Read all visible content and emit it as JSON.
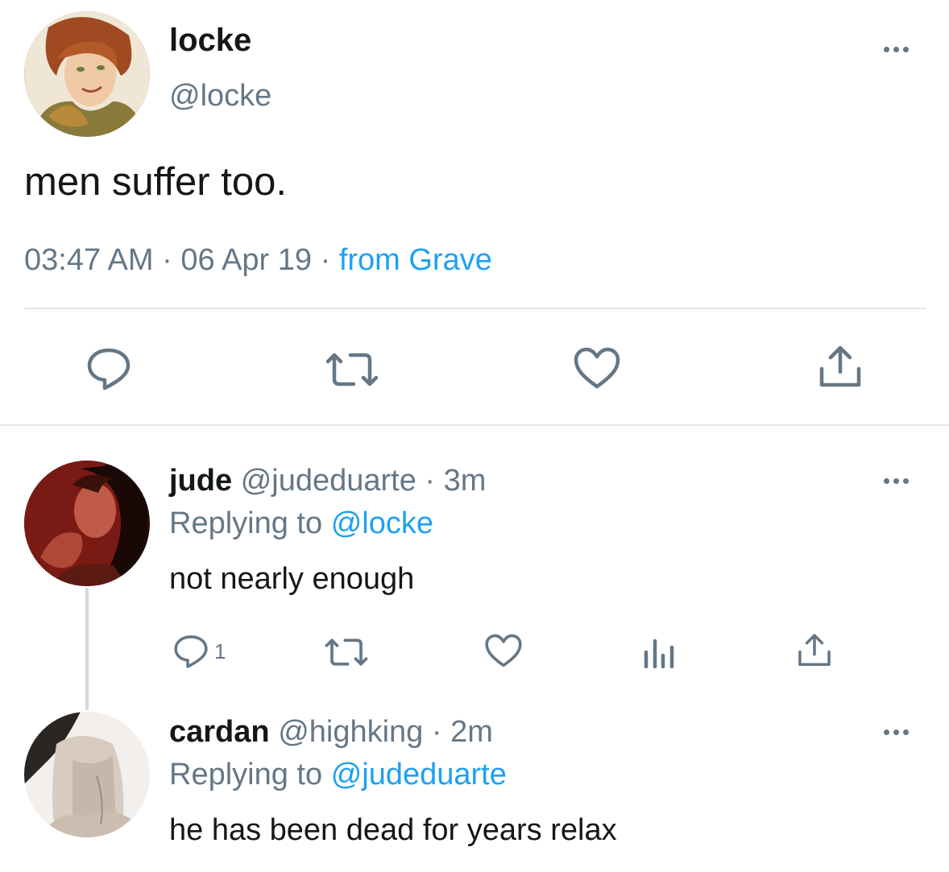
{
  "main_tweet": {
    "display_name": "locke",
    "handle": "@locke",
    "text": "men suffer too.",
    "time": "03:47 AM",
    "date": "06 Apr 19",
    "source": "from Grave",
    "sep": "·"
  },
  "replies": [
    {
      "display_name": "jude",
      "handle": "@judeduarte",
      "age": "3m",
      "sep": "·",
      "replying_prefix": "Replying to",
      "replying_to": "@locke",
      "text": "not nearly enough",
      "reply_count": "1"
    },
    {
      "display_name": "cardan",
      "handle": "@highking",
      "age": "2m",
      "sep": "·",
      "replying_prefix": "Replying to",
      "replying_to": "@judeduarte",
      "text": "he has been dead for years relax"
    }
  ],
  "icons": [
    "more-icon",
    "reply-icon",
    "retweet-icon",
    "like-icon",
    "share-icon",
    "analytics-icon"
  ],
  "colors": {
    "link": "#1da1f2",
    "secondary": "#657786",
    "divider": "#e1e8ed",
    "text": "#14171a"
  }
}
